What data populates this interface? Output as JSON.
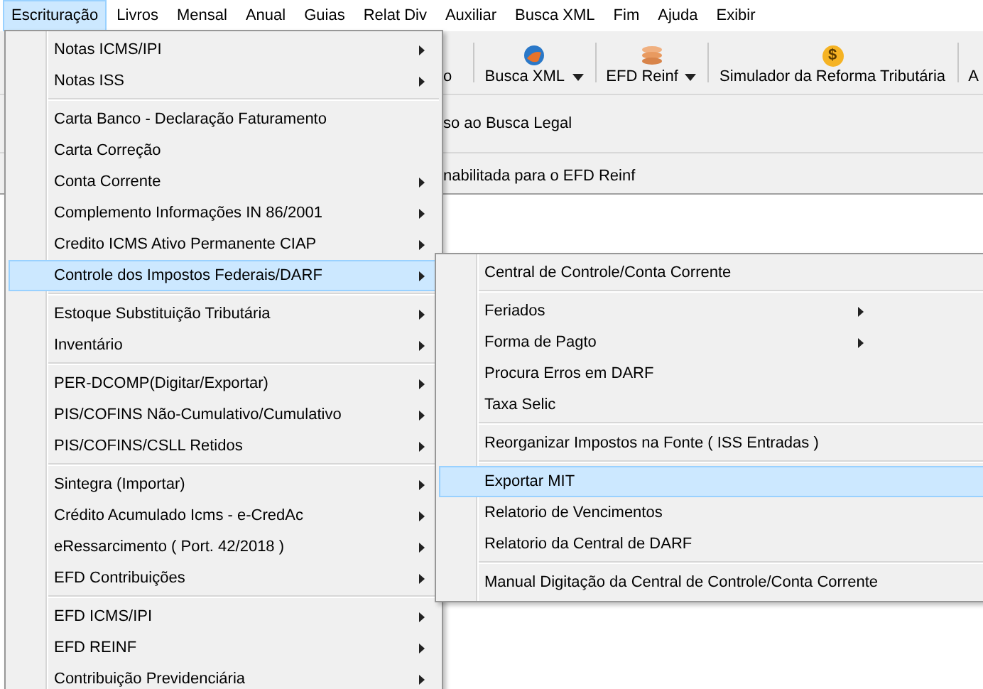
{
  "menu_bar": [
    {
      "label": "Escrituração",
      "selected": true
    },
    {
      "label": "Livros",
      "selected": false
    },
    {
      "label": "Mensal",
      "selected": false
    },
    {
      "label": "Anual",
      "selected": false
    },
    {
      "label": "Guias",
      "selected": false
    },
    {
      "label": "Relat Div",
      "selected": false
    },
    {
      "label": "Auxiliar",
      "selected": false
    },
    {
      "label": "Busca XML",
      "selected": false
    },
    {
      "label": "Fim",
      "selected": false
    },
    {
      "label": "Ajuda",
      "selected": false
    },
    {
      "label": "Exibir",
      "selected": false
    }
  ],
  "toolbar": [
    {
      "label": "o",
      "kind": "plain",
      "has_dropdown": false
    },
    {
      "label": "Busca XML",
      "kind": "globe",
      "has_dropdown": true
    },
    {
      "label": "EFD Reinf",
      "kind": "coins",
      "has_dropdown": true
    },
    {
      "label": "Simulador da Reforma Tributária",
      "kind": "coin",
      "glyph": "$",
      "has_dropdown": false
    },
    {
      "label": "A",
      "kind": "plain"
    }
  ],
  "messages": [
    "so ao Busca Legal",
    "nabilitada para o EFD Reinf"
  ],
  "menu": [
    {
      "kind": "item",
      "label": "Notas ICMS/IPI",
      "has_submenu": true,
      "selected": false
    },
    {
      "kind": "item",
      "label": "Notas ISS",
      "has_submenu": true,
      "selected": false
    },
    {
      "kind": "separator"
    },
    {
      "kind": "item",
      "label": "Carta Banco - Declaração Faturamento",
      "has_submenu": false,
      "selected": false
    },
    {
      "kind": "item",
      "label": "Carta Correção",
      "has_submenu": false,
      "selected": false
    },
    {
      "kind": "item",
      "label": "Conta Corrente",
      "has_submenu": true,
      "selected": false
    },
    {
      "kind": "item",
      "label": "Complemento Informações IN 86/2001",
      "has_submenu": true,
      "selected": false
    },
    {
      "kind": "item",
      "label": "Credito ICMS Ativo Permanente CIAP",
      "has_submenu": true,
      "selected": false
    },
    {
      "kind": "item",
      "label": "Controle dos Impostos Federais/DARF",
      "has_submenu": true,
      "selected": true
    },
    {
      "kind": "separator"
    },
    {
      "kind": "item",
      "label": "Estoque Substituição Tributária",
      "has_submenu": true,
      "selected": false
    },
    {
      "kind": "item",
      "label": "Inventário",
      "has_submenu": true,
      "selected": false
    },
    {
      "kind": "separator"
    },
    {
      "kind": "item",
      "label": "PER-DCOMP(Digitar/Exportar)",
      "has_submenu": true,
      "selected": false
    },
    {
      "kind": "item",
      "label": "PIS/COFINS Não-Cumulativo/Cumulativo",
      "has_submenu": true,
      "selected": false
    },
    {
      "kind": "item",
      "label": "PIS/COFINS/CSLL Retidos",
      "has_submenu": true,
      "selected": false
    },
    {
      "kind": "separator"
    },
    {
      "kind": "item",
      "label": "Sintegra (Importar)",
      "has_submenu": true,
      "selected": false
    },
    {
      "kind": "item",
      "label": "Crédito Acumulado Icms - e-CredAc",
      "has_submenu": true,
      "selected": false
    },
    {
      "kind": "item",
      "label": "eRessarcimento ( Port. 42/2018 )",
      "has_submenu": true,
      "selected": false
    },
    {
      "kind": "item",
      "label": "EFD Contribuições",
      "has_submenu": true,
      "selected": false
    },
    {
      "kind": "separator"
    },
    {
      "kind": "item",
      "label": "EFD ICMS/IPI",
      "has_submenu": true,
      "selected": false
    },
    {
      "kind": "item",
      "label": "EFD REINF",
      "has_submenu": true,
      "selected": false
    },
    {
      "kind": "item",
      "label": "Contribuição Previdenciária",
      "has_submenu": true,
      "selected": false
    }
  ],
  "submenu": [
    {
      "kind": "item",
      "label": "Central de Controle/Conta Corrente",
      "has_submenu": false,
      "selected": false
    },
    {
      "kind": "separator"
    },
    {
      "kind": "item",
      "label": "Feriados",
      "has_submenu": true,
      "selected": false
    },
    {
      "kind": "item",
      "label": "Forma de Pagto",
      "has_submenu": true,
      "selected": false
    },
    {
      "kind": "item",
      "label": "Procura Erros em DARF",
      "has_submenu": false,
      "selected": false
    },
    {
      "kind": "item",
      "label": "Taxa Selic",
      "has_submenu": false,
      "selected": false
    },
    {
      "kind": "separator"
    },
    {
      "kind": "item",
      "label": "Reorganizar Impostos na Fonte ( ISS Entradas )",
      "has_submenu": false,
      "selected": false
    },
    {
      "kind": "separator"
    },
    {
      "kind": "item",
      "label": "Exportar MIT",
      "has_submenu": false,
      "selected": true
    },
    {
      "kind": "item",
      "label": "Relatorio de Vencimentos",
      "has_submenu": false,
      "selected": false
    },
    {
      "kind": "item",
      "label": "Relatorio da Central de DARF",
      "has_submenu": false,
      "selected": false
    },
    {
      "kind": "separator"
    },
    {
      "kind": "item",
      "label": "Manual Digitação da Central de Controle/Conta Corrente",
      "has_submenu": false,
      "selected": false
    }
  ]
}
